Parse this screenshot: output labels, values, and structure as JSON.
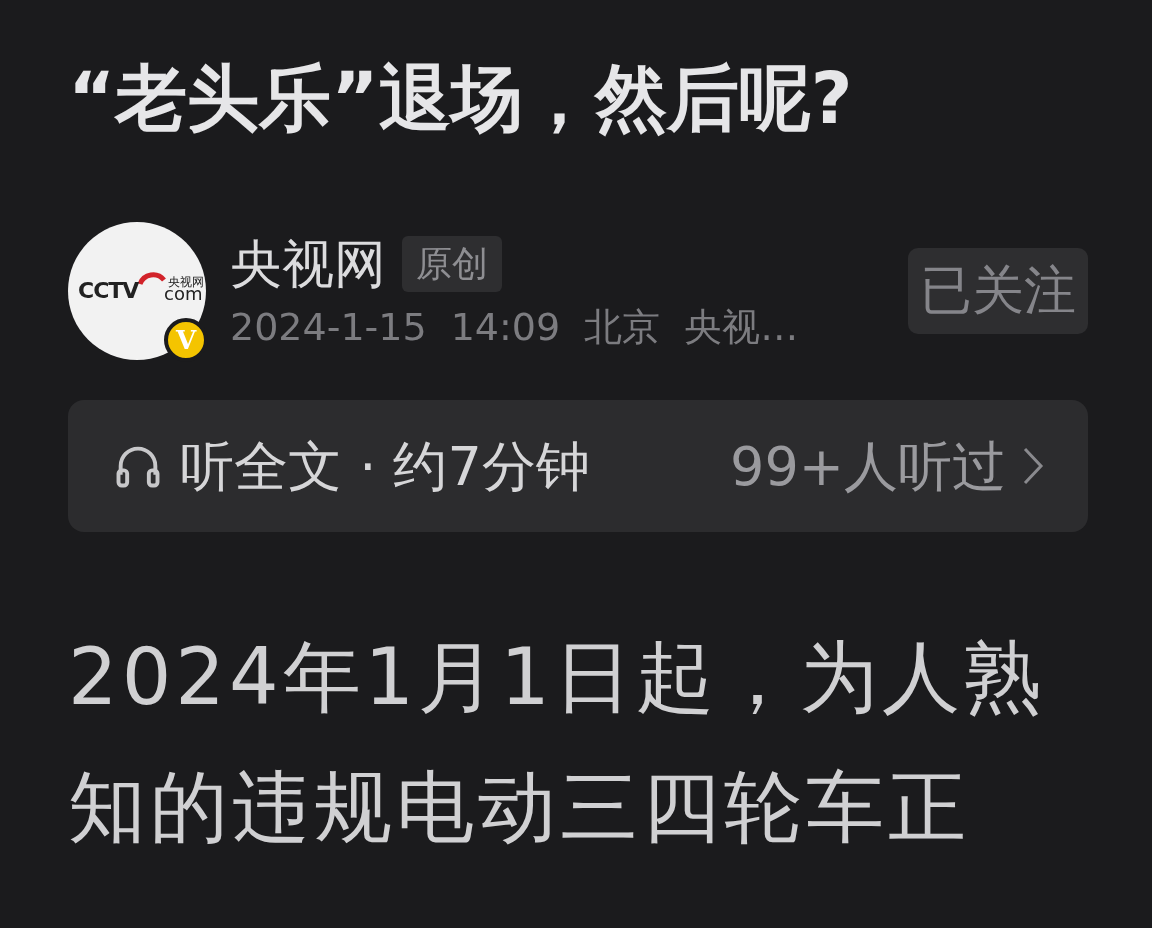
{
  "title": "“老头乐”退场，然后呢?",
  "author": {
    "name": "央视网",
    "tag": "原创",
    "avatar": {
      "logo_text": "CCTV",
      "logo_cn": "央视网",
      "logo_domain": "com",
      "verified_mark": "V"
    },
    "date": "2024-1-15",
    "time": "14:09",
    "location": "北京",
    "source": "央视…",
    "follow": {
      "label": "已关注",
      "followed": true
    }
  },
  "listen": {
    "label": "听全文 · 约7分钟",
    "count": "99+人听过"
  },
  "body": "2024年1月1日起，为人熟知的违规电动三四轮车正"
}
